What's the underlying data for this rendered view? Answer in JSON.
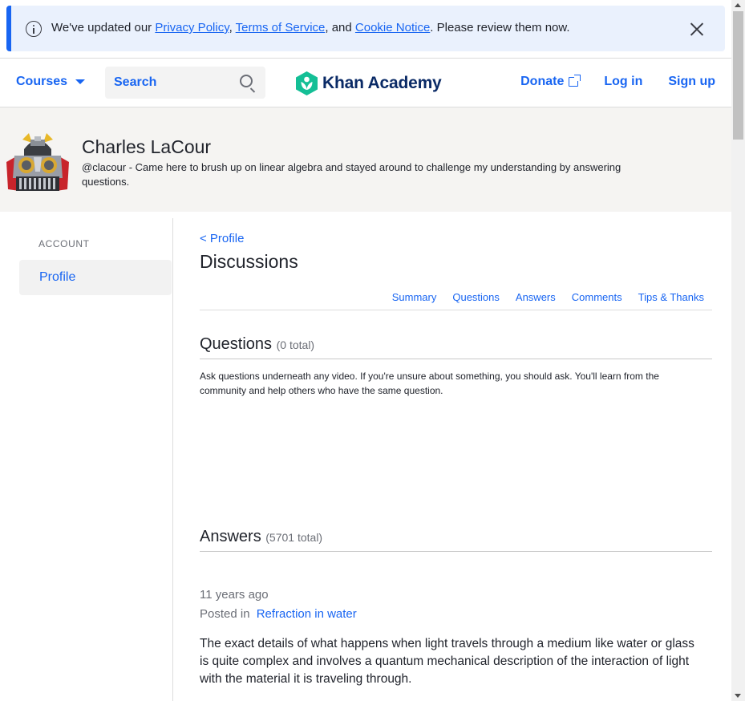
{
  "banner": {
    "pre": "We've updated our ",
    "privacy": "Privacy Policy",
    "sep1": ", ",
    "terms": "Terms of Service",
    "sep2": ", and ",
    "cookie": "Cookie Notice",
    "post": ". Please review them now."
  },
  "header": {
    "courses": "Courses",
    "search_placeholder": "Search",
    "logo": "Khan Academy",
    "donate": "Donate",
    "login": "Log in",
    "signup": "Sign up"
  },
  "profile": {
    "name": "Charles LaCour",
    "bio": "@clacour - Came here to brush up on linear algebra and stayed around to challenge my understanding by answering questions."
  },
  "sidebar": {
    "heading": "ACCOUNT",
    "items": [
      {
        "label": "Profile"
      }
    ]
  },
  "main": {
    "back": "< Profile",
    "title": "Discussions",
    "tabs": [
      "Summary",
      "Questions",
      "Answers",
      "Comments",
      "Tips & Thanks"
    ],
    "questions": {
      "title": "Questions",
      "count": "(0 total)",
      "desc": "Ask questions underneath any video. If you're unsure about something, you should ask. You'll learn from the community and help others who have the same question."
    },
    "answers": {
      "title": "Answers",
      "count": "(5701 total)",
      "items": [
        {
          "time": "11 years ago",
          "posted_in": "Posted in",
          "topic": "Refraction in water",
          "body": "The exact details of what happens when light travels through a medium like water or glass is quite complex and involves a quantum mechanical description of the interaction of light with the material it is traveling through."
        }
      ]
    }
  },
  "colors": {
    "accent": "#1865f2",
    "logo_green": "#14bf96",
    "logo_text": "#0a2a66",
    "banner_bg": "#eaf1fd",
    "profile_bg": "#f5f4f2"
  }
}
